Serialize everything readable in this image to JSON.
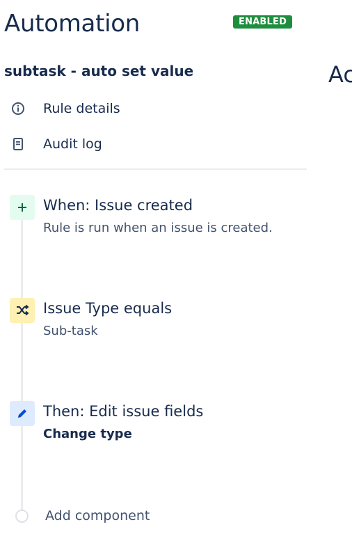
{
  "header": {
    "title": "Automation",
    "status_badge": "ENABLED"
  },
  "rule": {
    "name": "subtask - auto set value"
  },
  "right_panel": {
    "heading_fragment": "Ac"
  },
  "nav": [
    {
      "label": "Rule details",
      "icon": "info-icon"
    },
    {
      "label": "Audit log",
      "icon": "document-icon"
    }
  ],
  "steps": [
    {
      "icon": "plus-icon",
      "title": "When: Issue created",
      "subtitle": "Rule is run when an issue is created.",
      "color": "#e3fcef",
      "icon_color": "#006644"
    },
    {
      "icon": "shuffle-icon",
      "title": "Issue Type equals",
      "subtitle": "Sub-task",
      "color": "#fff0b3",
      "icon_color": "#172b4d"
    },
    {
      "icon": "pencil-icon",
      "title": "Then: Edit issue fields",
      "subtitle": "Change type",
      "color": "#deebff",
      "icon_color": "#0052cc"
    }
  ],
  "add_component": {
    "label": "Add component"
  },
  "colors": {
    "badge": "#1e8e3e",
    "text": "#172b4d",
    "muted": "#42526e",
    "divider": "#ebecf0"
  }
}
